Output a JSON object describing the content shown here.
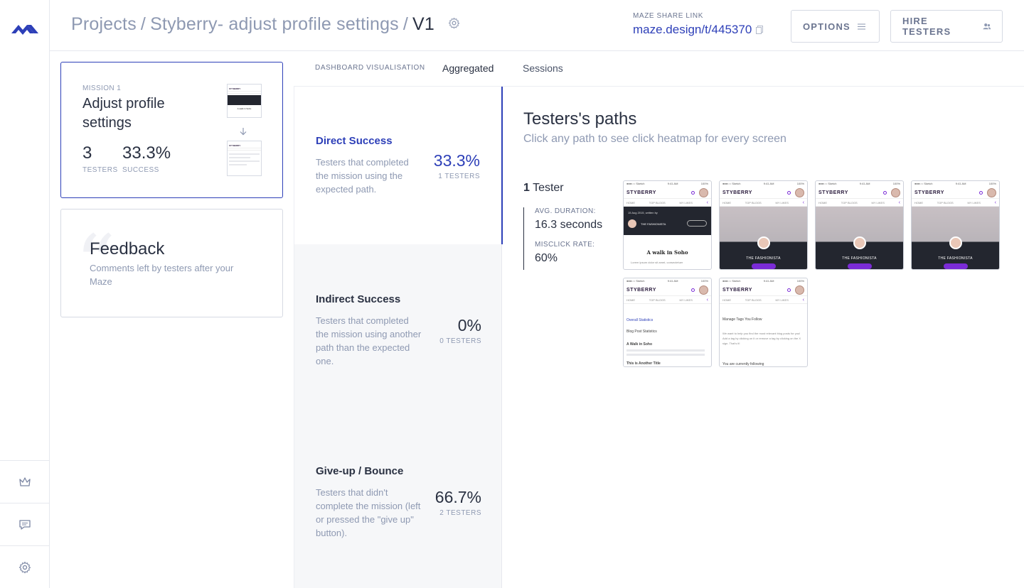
{
  "breadcrumb": {
    "projects": "Projects",
    "project": "Styberry- adjust profile settings",
    "version": "V1"
  },
  "share": {
    "label": "MAZE SHARE LINK",
    "url": "maze.design/t/445370"
  },
  "header_buttons": {
    "options": "OPTIONS",
    "hire": "HIRE TESTERS"
  },
  "mission": {
    "label": "MISSION 1",
    "title": "Adjust profile settings",
    "testers_value": "3",
    "testers_label": "TESTERS",
    "success_value": "33.3%",
    "success_label": "SUCCESS"
  },
  "feedback": {
    "title": "Feedback",
    "description": "Comments left by testers after your Maze"
  },
  "tabs": {
    "dashboard": "DASHBOARD VISUALISATION",
    "aggregated": "Aggregated",
    "sessions": "Sessions"
  },
  "outcomes": [
    {
      "title": "Direct Success",
      "description": "Testers that completed the mission using the expected path.",
      "percent": "33.3%",
      "count": "1 TESTERS"
    },
    {
      "title": "Indirect Success",
      "description": "Testers that completed the mission using another path than the expected one.",
      "percent": "0%",
      "count": "0 TESTERS"
    },
    {
      "title": "Give-up / Bounce",
      "description": "Testers that didn't complete the mission (left or pressed the \"give up\" button).",
      "percent": "66.7%",
      "count": "2 TESTERS"
    }
  ],
  "paths": {
    "title": "Testers's paths",
    "subtitle": "Click any path to see click heatmap for every screen",
    "tester_number": "1",
    "tester_word": "Tester",
    "avg_duration_label": "AVG. DURATION:",
    "avg_duration_value": "16.3 seconds",
    "misclick_label": "MISCLICK RATE:",
    "misclick_value": "60%"
  },
  "screens": {
    "brand": "STYBERRY",
    "status_left": "●●●○○ Sketch",
    "status_time": "9:41 AM",
    "status_right": "100%",
    "nav_home": "HOME",
    "nav_top": "TOP BLOGS",
    "nav_likes": "MY LIKES",
    "author_date": "15 Aug 2015, written by",
    "author_name": "THE FASHIONISTA",
    "story_title": "A walk in Soho",
    "lorem": "Lorem ipsum dolor sit amet, consectetuer",
    "profile_name": "THE FASHIONISTA",
    "stats_title": "Overall Statistics",
    "stats_sub": "Blog Post Statistics",
    "stats_item": "A Walk in Soho",
    "stats_item2": "This is Another Title",
    "tags_title": "Manage Tags You Follow",
    "tags_text": "We want to help you find the most relevant blog posts for you! Add a tag by clicking on it or remove a tag by clicking on the X sign. That's it!",
    "tags_following": "You are currently following"
  },
  "colors": {
    "accent": "#2d3fb8",
    "brand_purple": "#7a2bd6",
    "muted": "#8e99b2"
  },
  "icons": {
    "logo": "maze-logo",
    "rail": [
      "crown-icon",
      "comment-icon",
      "gear-icon"
    ]
  }
}
